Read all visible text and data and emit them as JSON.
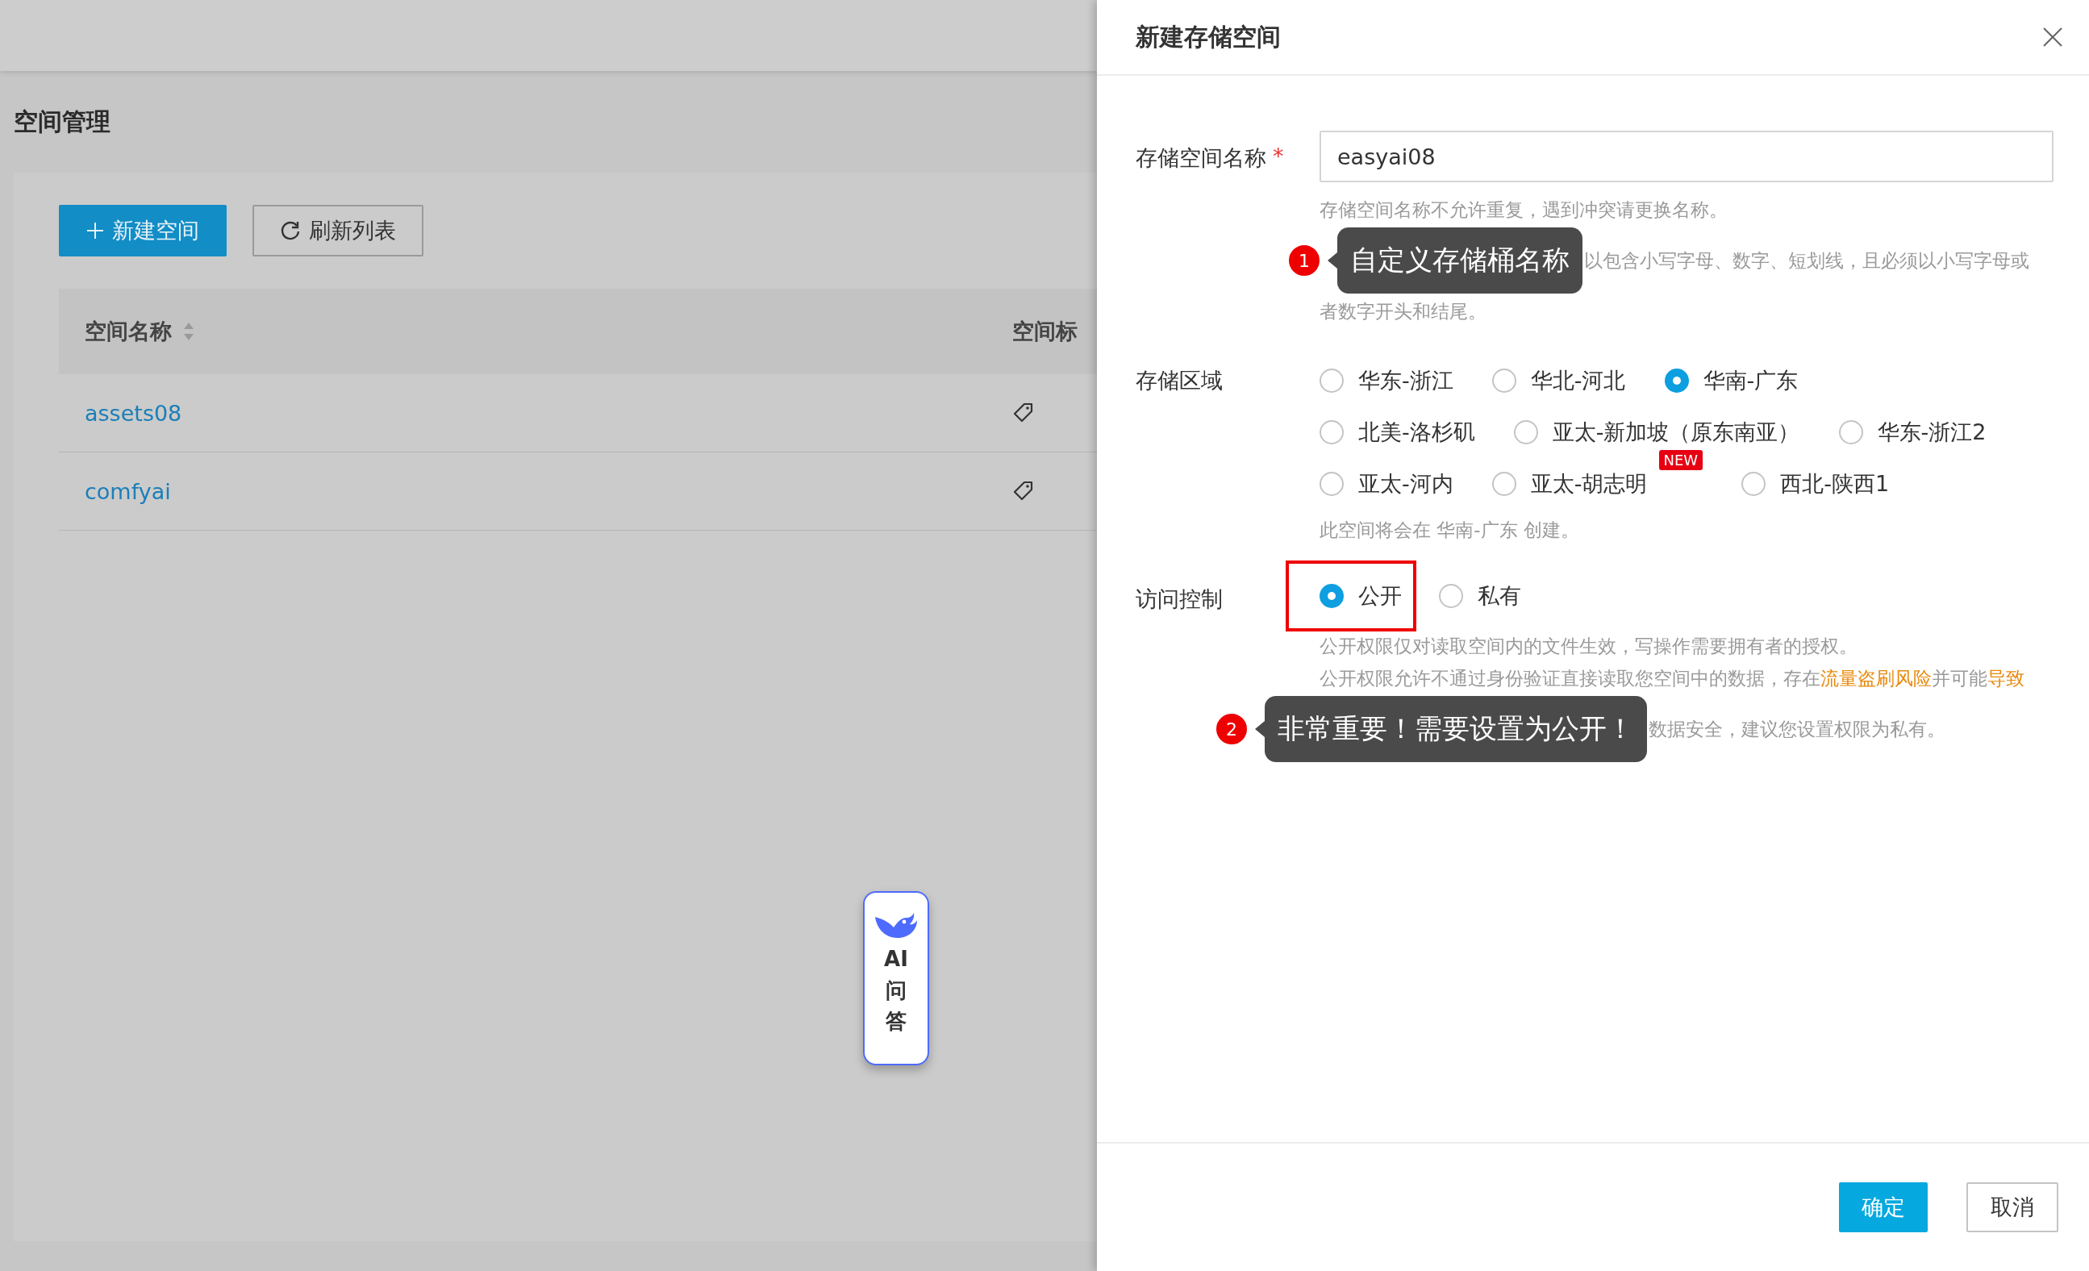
{
  "page": {
    "title": "空间管理"
  },
  "toolbar": [
    {
      "kind": "create",
      "label": "新建空间"
    },
    {
      "kind": "refresh",
      "label": "刷新列表"
    }
  ],
  "table": {
    "columns": [
      {
        "label": "空间名称",
        "sortable": true
      },
      {
        "label": "空间标"
      }
    ],
    "rows": [
      {
        "name": "assets08"
      },
      {
        "name": "comfyai"
      }
    ]
  },
  "ai_button": {
    "lines": [
      "AI",
      "问",
      "答"
    ]
  },
  "dialog": {
    "title": "新建存储空间",
    "name_field": {
      "label": "存储空间名称",
      "required_mark": "*",
      "value": "easyai08",
      "hint_lines": [
        "存储空间名称不允许重复，遇到冲突请更换名称。",
        "以包含小写字母、数字、短划线，且必须以小写字母或",
        "者数字开头和结尾。"
      ],
      "callout": {
        "number": "1",
        "text": "自定义存储桶名称"
      }
    },
    "region": {
      "label": "存储区域",
      "option_rows": [
        [
          {
            "label": "华东-浙江",
            "selected": false
          },
          {
            "label": "华北-河北",
            "selected": false
          },
          {
            "label": "华南-广东",
            "selected": true
          }
        ],
        [
          {
            "label": "北美-洛杉矶",
            "selected": false
          },
          {
            "label": "亚太-新加坡（原东南亚）",
            "selected": false
          },
          {
            "label": "华东-浙江2",
            "selected": false
          }
        ],
        [
          {
            "label": "亚太-河内",
            "selected": false
          },
          {
            "label": "亚太-胡志明",
            "selected": false,
            "badge": "NEW"
          },
          {
            "label": "西北-陕西1",
            "selected": false
          }
        ]
      ],
      "note": "此空间将会在 华南-广东 创建。"
    },
    "access": {
      "label": "访问控制",
      "options": [
        {
          "label": "公开",
          "selected": true,
          "highlighted": true
        },
        {
          "label": "私有",
          "selected": false,
          "highlighted": false
        }
      ],
      "hint_lines": [
        [
          {
            "kind": "text",
            "text": "公开权限仅对读取空间内的文件生效，写操作需要拥有者的授权。"
          }
        ],
        [
          {
            "kind": "text",
            "text": "公开权限允许不通过身份验证直接读取您空间中的数据，存在"
          },
          {
            "kind": "warning",
            "text": "流量盗刷风险"
          },
          {
            "kind": "text",
            "text": "并可能"
          },
          {
            "kind": "warning",
            "text": "导致"
          }
        ],
        [
          {
            "kind": "text",
            "text": "数据安全，建议您设置权限为私有。"
          }
        ]
      ],
      "callout": {
        "number": "2",
        "text": "非常重要！需要设置为公开！"
      }
    },
    "buttons": [
      {
        "kind": "primary",
        "label": "确定"
      },
      {
        "kind": "default",
        "label": "取消"
      }
    ]
  }
}
